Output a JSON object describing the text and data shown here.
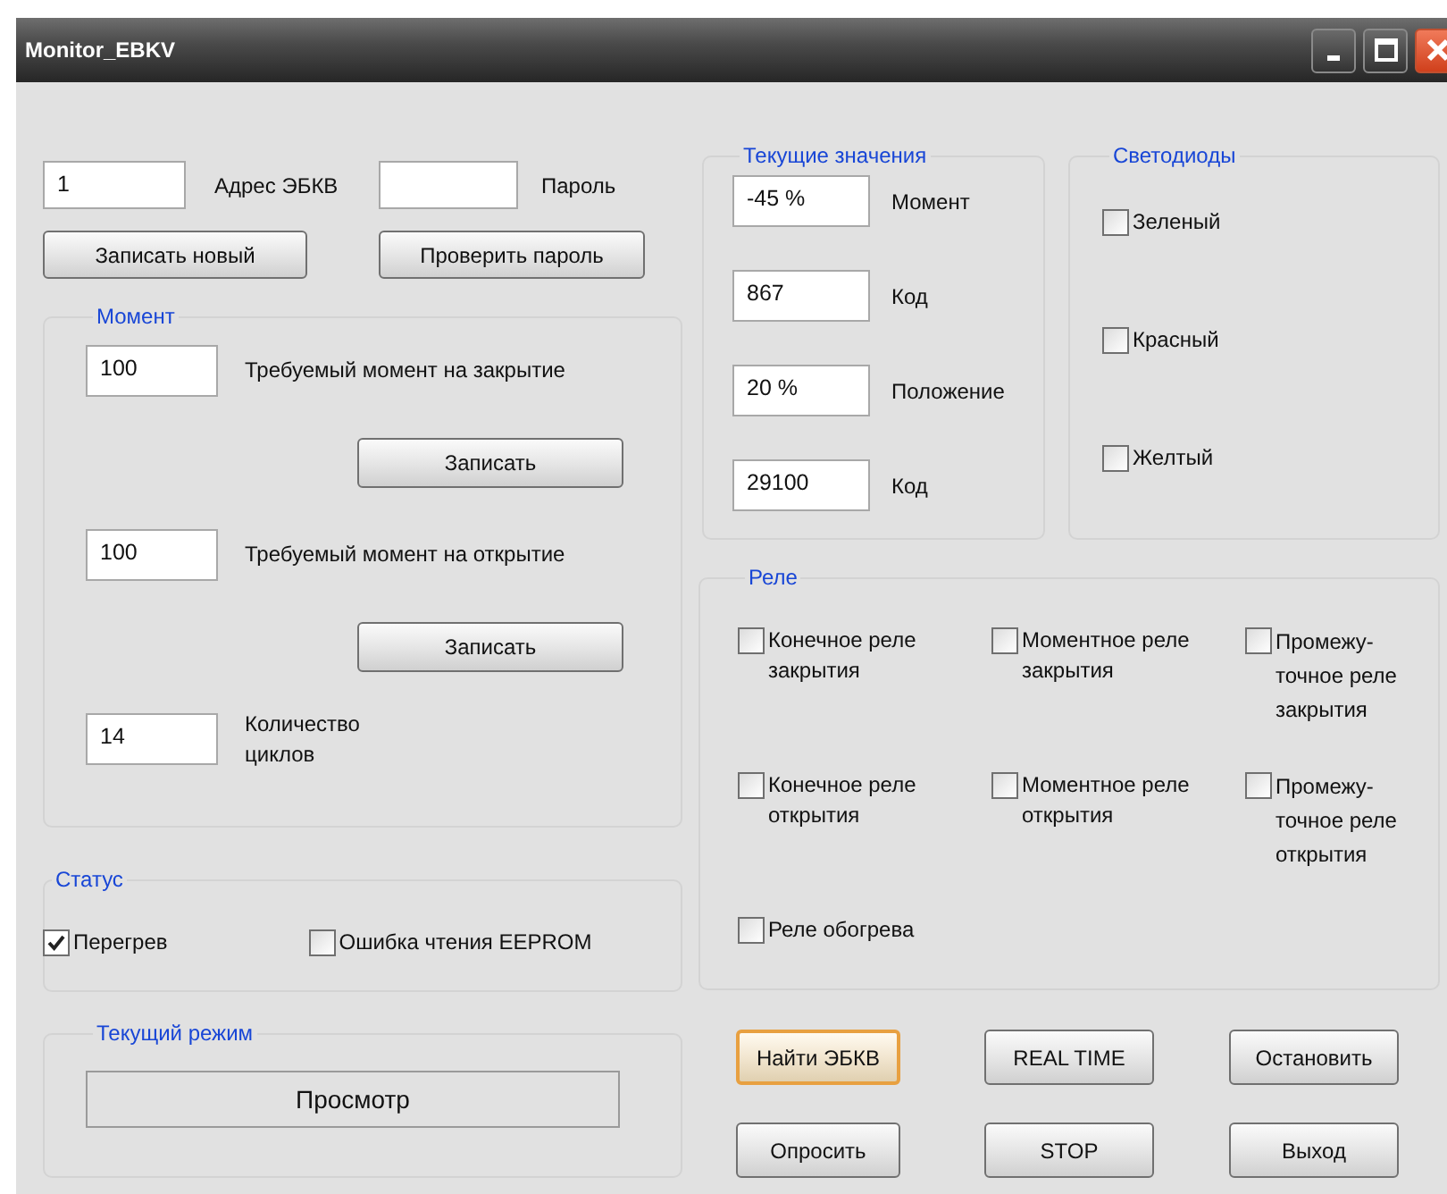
{
  "window": {
    "title": "Monitor_EBKV"
  },
  "address": {
    "value": "1",
    "label": "Адрес ЭБКВ"
  },
  "password": {
    "label": "Пароль"
  },
  "top_buttons": [
    "Записать новый",
    "Проверить пароль"
  ],
  "moment": {
    "title": "Момент",
    "rows": [
      {
        "value": "100",
        "label": "Требуемый момент на закрытие",
        "button": "Записать"
      },
      {
        "value": "100",
        "label": "Требуемый момент на открытие",
        "button": "Записать"
      },
      {
        "value": "14",
        "label": "Количество циклов"
      }
    ]
  },
  "status": {
    "title": "Статус",
    "checks": [
      {
        "label": "Перегрев",
        "checked": true
      },
      {
        "label": "Ошибка чтения EEPROM",
        "checked": false
      }
    ]
  },
  "mode": {
    "title": "Текущий режим",
    "value": "Просмотр"
  },
  "current_values": {
    "title": "Текущие значения",
    "rows": [
      {
        "value": "-45 %",
        "label": "Момент"
      },
      {
        "value": "867",
        "label": "Код"
      },
      {
        "value": "20 %",
        "label": "Положение"
      },
      {
        "value": "29100",
        "label": "Код"
      }
    ]
  },
  "leds": {
    "title": "Светодиоды",
    "items": [
      {
        "label": "Зеленый",
        "checked": false
      },
      {
        "label": "Красный",
        "checked": false
      },
      {
        "label": "Желтый",
        "checked": false
      }
    ]
  },
  "relays": {
    "title": "Реле",
    "items": [
      {
        "label": "Конечное реле закрытия",
        "checked": false
      },
      {
        "label": "Моментное реле закрытия",
        "checked": false
      },
      {
        "label": "Промежу-точное реле закрытия",
        "checked": false
      },
      {
        "label": "Конечное реле открытия",
        "checked": false
      },
      {
        "label": "Моментное реле открытия",
        "checked": false
      },
      {
        "label": "Промежу-точное реле открытия",
        "checked": false
      },
      {
        "label": "Реле обогрева",
        "checked": false
      }
    ]
  },
  "buttons": [
    {
      "label": "Найти ЭБКВ",
      "focused": true
    },
    {
      "label": "REAL TIME",
      "focused": false
    },
    {
      "label": "Остановить",
      "focused": false
    },
    {
      "label": "Опросить",
      "focused": false
    },
    {
      "label": "STOP",
      "focused": false
    },
    {
      "label": "Выход",
      "focused": false
    }
  ]
}
